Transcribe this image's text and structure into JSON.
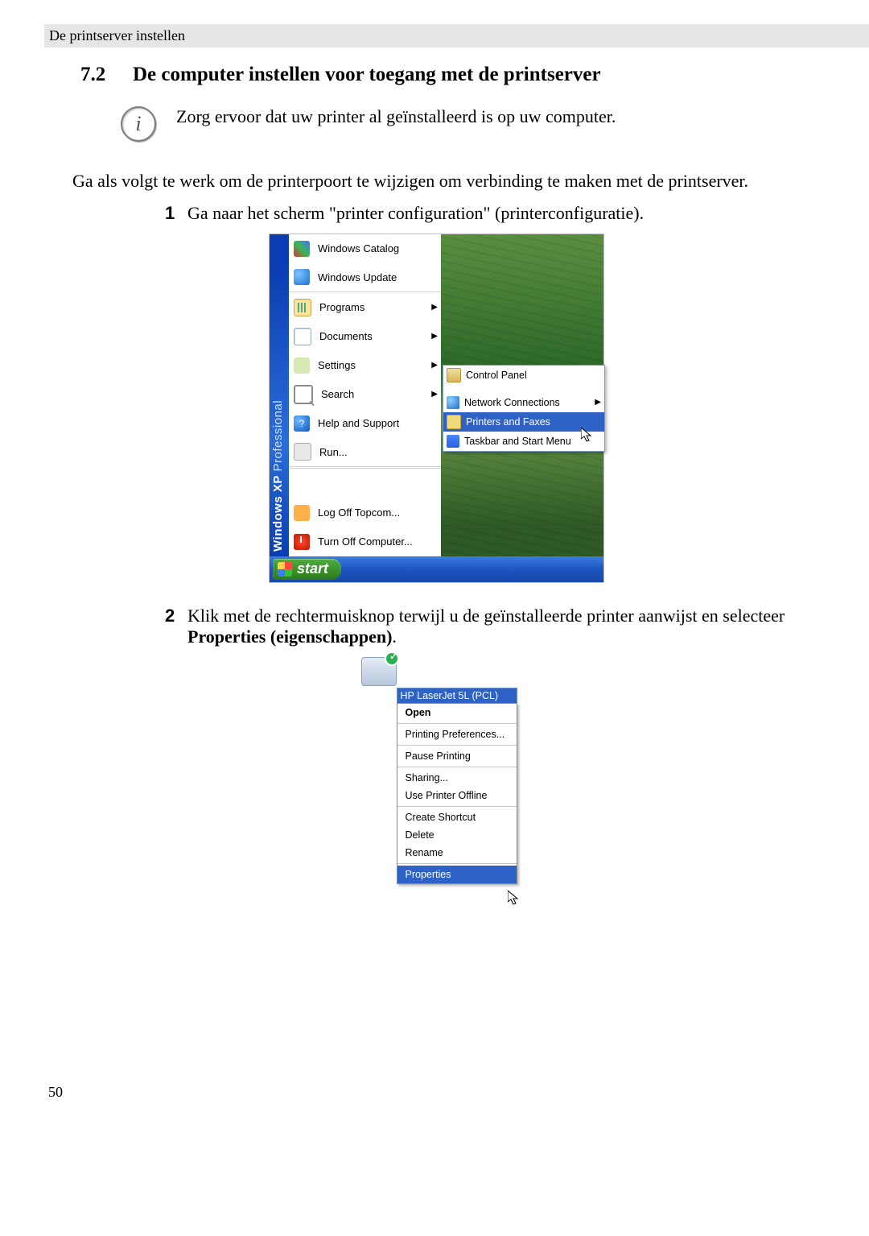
{
  "header": {
    "running": "De printserver instellen"
  },
  "section": {
    "number": "7.2",
    "title": "De computer instellen voor toegang met de printserver"
  },
  "note": {
    "text": "Zorg ervoor dat uw printer al geïnstalleerd is op uw computer."
  },
  "intro": "Ga als volgt te werk om de printerpoort te wijzigen om verbinding te maken met de printserver.",
  "steps": {
    "s1_num": "1",
    "s1": "Ga naar het scherm \"printer configuration\" (printerconfiguratie).",
    "s2_num": "2",
    "s2a": "Klik met de rechtermuisknop terwijl u de geïnstalleerde printer aanwijst en selecteer ",
    "s2b": "Properties (eigenschappen)",
    "s2c": "."
  },
  "start_menu": {
    "brand_bold": "Windows XP",
    "brand_light": "Professional",
    "items": {
      "catalog": "Windows Catalog",
      "update": "Windows Update",
      "programs": "Programs",
      "documents": "Documents",
      "settings": "Settings",
      "search": "Search",
      "help": "Help and Support",
      "run": "Run...",
      "logoff": "Log Off Topcom...",
      "turnoff": "Turn Off Computer..."
    },
    "submenu": {
      "control_panel": "Control Panel",
      "network": "Network Connections",
      "printers_faxes": "Printers and Faxes",
      "taskbar": "Taskbar and Start Menu"
    },
    "start_button": "start"
  },
  "context_menu": {
    "printer_name": "HP LaserJet 5L (PCL)",
    "items": {
      "open": "Open",
      "prefs": "Printing Preferences...",
      "pause": "Pause Printing",
      "sharing": "Sharing...",
      "offline": "Use Printer Offline",
      "shortcut": "Create Shortcut",
      "delete": "Delete",
      "rename": "Rename",
      "properties": "Properties"
    }
  },
  "page_number": "50"
}
